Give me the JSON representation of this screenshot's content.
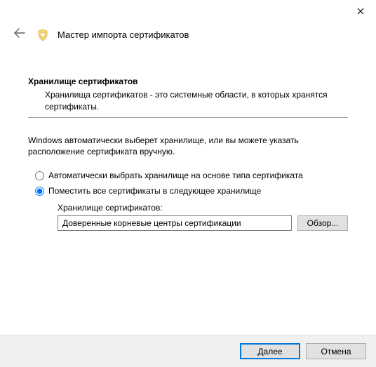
{
  "header": {
    "title": "Мастер импорта сертификатов"
  },
  "section": {
    "title": "Хранилище сертификатов",
    "description": "Хранилища сертификатов - это системные области, в которых хранятся сертификаты."
  },
  "info": "Windows автоматически выберет хранилище, или вы можете указать расположение сертификата вручную.",
  "radios": {
    "auto": "Автоматически выбрать хранилище на основе типа сертификата",
    "manual": "Поместить все сертификаты в следующее хранилище"
  },
  "store": {
    "label": "Хранилище сертификатов:",
    "value": "Доверенные корневые центры сертификации",
    "browse": "Обзор..."
  },
  "footer": {
    "next": "Далее",
    "cancel": "Отмена"
  }
}
